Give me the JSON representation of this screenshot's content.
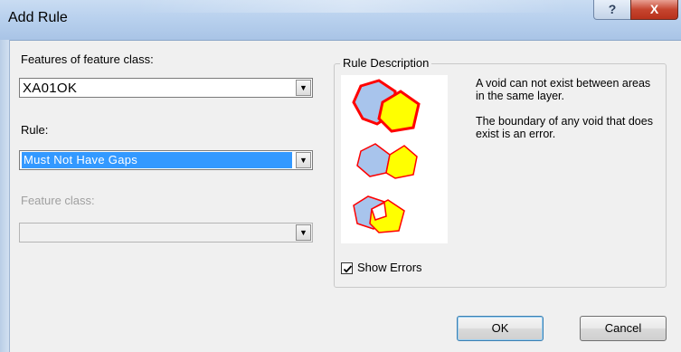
{
  "window": {
    "title": "Add Rule",
    "help_glyph": "?",
    "close_glyph": "X"
  },
  "form": {
    "features_label": "Features of feature class:",
    "features_value": "XA01OK",
    "rule_label": "Rule:",
    "rule_value": "Must Not Have Gaps",
    "feature_class_label": "Feature class:",
    "feature_class_value": "",
    "dropdown_glyph": "▼"
  },
  "rule_description": {
    "title": "Rule Description",
    "text_1": "A void can not exist between areas in the same layer.",
    "text_2": "The boundary of any void that does exist is an error.",
    "show_errors_label": "Show Errors",
    "show_errors_checked": true
  },
  "buttons": {
    "ok_label": "OK",
    "cancel_label": "Cancel"
  },
  "colors": {
    "polygon_blue": "#a8c4ec",
    "polygon_yellow": "#ffff00",
    "error_red": "#ff0000",
    "selection": "#3399ff"
  }
}
